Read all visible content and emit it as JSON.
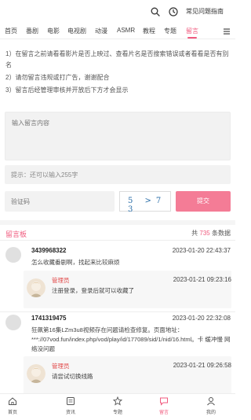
{
  "header": {
    "faq_label": "常见问题指南",
    "icons": [
      "search-icon",
      "history-icon"
    ]
  },
  "nav": {
    "tabs": [
      {
        "label": "首页"
      },
      {
        "label": "番剧"
      },
      {
        "label": "电影"
      },
      {
        "label": "电视剧"
      },
      {
        "label": "动漫"
      },
      {
        "label": "ASMR"
      },
      {
        "label": "教程"
      },
      {
        "label": "专题"
      },
      {
        "label": "留言"
      }
    ],
    "active_index": 8,
    "accent_color": "#f05a7e"
  },
  "notice": {
    "lines": [
      "1）在留言之前请看看影片是否上映过、查看片名是否搜索错误或者看看是否有别名",
      "2）请勿留言违规或打广告，谢谢配合",
      "3）留言后经管理审核并开放后下方才会显示"
    ]
  },
  "form": {
    "content_placeholder": "输入留言内容",
    "hint": "提示：还可以输入255字",
    "captcha_placeholder": "验证码",
    "captcha_text": "5 >7 3",
    "submit_label": "提交"
  },
  "board": {
    "title": "留言板",
    "count_prefix": "共",
    "count": "735",
    "count_suffix": "条数据"
  },
  "messages": [
    {
      "user": "3439968322",
      "time": "2023-01-20 22:43:37",
      "text": "怎么收藏番剧啊，找起来比较麻烦",
      "reply": {
        "name": "管理员",
        "time": "2023-01-21 09:23:16",
        "text": "注册登录，登录后就可以收藏了"
      }
    },
    {
      "user": "1741319475",
      "time": "2023-01-20 22:32:08",
      "text": "狂飙第16集LZm3u8视频存在问题请检查修复。页面地址：***://07vod.fun/index.php/vod/play/id/177089/sid/1/nid/16.html。卡 缓冲慢 网络没问题",
      "reply": {
        "name": "管理员",
        "time": "2023-01-21 09:26:58",
        "text": "请尝试切换线路"
      }
    }
  ],
  "bottom_nav": {
    "items": [
      {
        "label": "首页",
        "icon": "home-icon"
      },
      {
        "label": "资讯",
        "icon": "news-icon"
      },
      {
        "label": "专题",
        "icon": "star-icon"
      },
      {
        "label": "留言",
        "icon": "chat-icon"
      },
      {
        "label": "我的",
        "icon": "user-icon"
      }
    ],
    "active_index": 3
  }
}
